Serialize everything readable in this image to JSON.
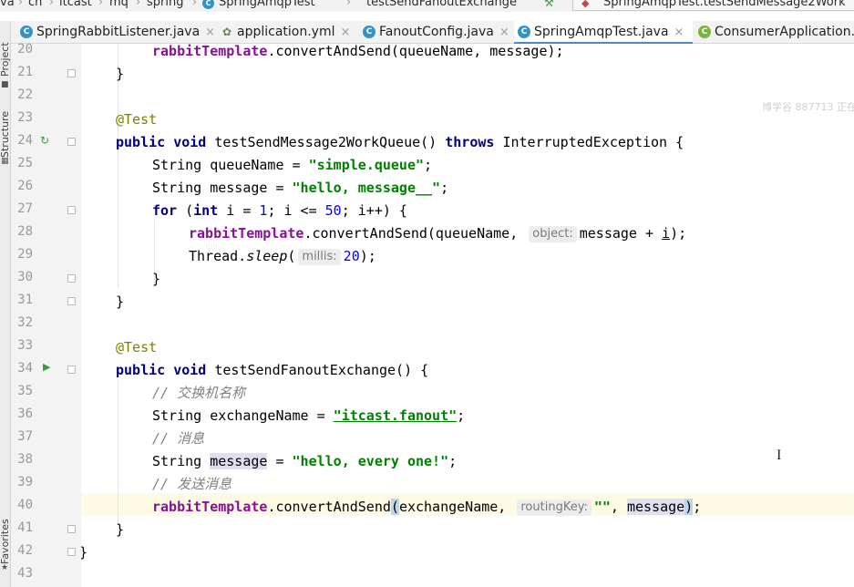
{
  "breadcrumb": {
    "items": [
      "va",
      "cn",
      "itcast",
      "mq",
      "spring",
      "SpringAmqpTest",
      "testSendFanoutExchange"
    ],
    "run_config": "SpringAmqpTest.testSendMessage2Work"
  },
  "tabs": [
    {
      "label": "SpringRabbitListener.java",
      "close": "×"
    },
    {
      "label": "application.yml",
      "close": "×"
    },
    {
      "label": "FanoutConfig.java",
      "close": "×"
    },
    {
      "label": "SpringAmqpTest.java",
      "close": "×"
    },
    {
      "label": "ConsumerApplication.j",
      "close": ""
    }
  ],
  "sidebar": {
    "project": "Project",
    "structure": "Structure",
    "favorites": "Favorites"
  },
  "gutter": {
    "line_numbers": [
      "20",
      "21",
      "22",
      "23",
      "24",
      "25",
      "26",
      "27",
      "28",
      "29",
      "30",
      "31",
      "32",
      "33",
      "34",
      "35",
      "36",
      "37",
      "38",
      "39",
      "40",
      "41",
      "42",
      "43"
    ]
  },
  "code": {
    "line20": {
      "field": "rabbitTemplate",
      "rest": ".convertAndSend(queueName, message);"
    },
    "line21": "}",
    "line23": "@Test",
    "line24": {
      "kw1": "public",
      "kw2": "void",
      "method": " testSendMessage2WorkQueue() ",
      "kw3": "throws",
      "rest": " InterruptedException {"
    },
    "line25": {
      "decl": "String queueName = ",
      "str": "\"simple.queue\"",
      "end": ";"
    },
    "line26": {
      "decl": "String message = ",
      "str": "\"hello, message__\"",
      "end": ";"
    },
    "line27": {
      "kw": "for",
      "p1": " (",
      "kw2": "int",
      "p2": " i = ",
      "n1": "1",
      "p3": "; i <= ",
      "n2": "50",
      "p4": "; i++) {"
    },
    "line28": {
      "field": "rabbitTemplate",
      "p1": ".convertAndSend(queueName, ",
      "hint": "object:",
      "p2": "message + ",
      "var": "i",
      "end": ");"
    },
    "line29": {
      "p1": "Thread.",
      "stat": "sleep",
      "p2": "(",
      "hint": "millis:",
      "num": "20",
      "end": ");"
    },
    "line30": "}",
    "line31": "}",
    "line33": "@Test",
    "line34": {
      "kw1": "public",
      "kw2": "void",
      "rest": " testSendFanoutExchange() {"
    },
    "line35": "// 交换机名称",
    "line36": {
      "decl": "String exchangeName = ",
      "str": "\"itcast.fanout\"",
      "end": ";"
    },
    "line37": "// 消息",
    "line38": {
      "p1": "String ",
      "ref": "message",
      "p2": " = ",
      "str": "\"hello, every one!\"",
      "end": ";"
    },
    "line39": "// 发送消息",
    "line40": {
      "field": "rabbitTemplate",
      "p1": ".convertAndSend",
      "lp": "(",
      "p2": "exchangeName, ",
      "hint": "routingKey:",
      "str": "\"\"",
      "p3": ", ",
      "ref": "message",
      "rp": ")",
      "end": ";"
    },
    "line41": "}",
    "line42": "}"
  },
  "watermark": "博学谷 887713 正在",
  "caret": "I"
}
